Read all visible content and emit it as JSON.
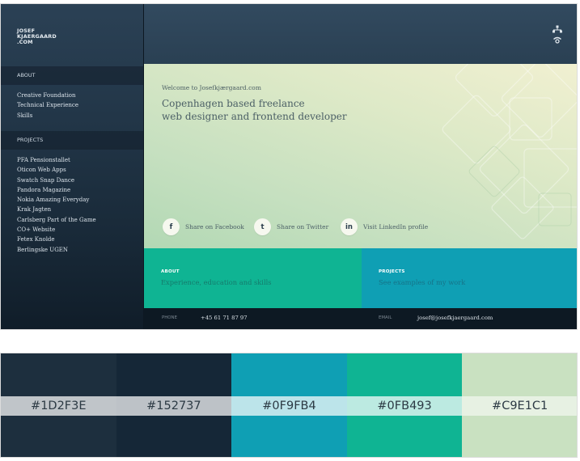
{
  "sidebar": {
    "logo_lines": [
      "JOSEF",
      "KJAERGAARD",
      ".COM"
    ],
    "about_heading": "ABOUT",
    "about_items": [
      "Creative Foundation",
      "Technical Experience",
      "Skills"
    ],
    "projects_heading": "PROJECTS",
    "project_items": [
      "PFA Pensionstallet",
      "Oticon Web Apps",
      "Swatch Snap Dance",
      "Pandora Magazine",
      "Nokia Amazing Everyday",
      "Krak Jagten",
      "Carlsberg Part of the Game",
      "CO+ Website",
      "Fetex Knolde",
      "Berlingske UGEN"
    ]
  },
  "topbar": {
    "icons": [
      "network-icon",
      "wifi-icon"
    ]
  },
  "hero": {
    "welcome": "Welcome to Josefkjærgaard.com",
    "headline_line1": "Copenhagen based freelance",
    "headline_line2": "web designer and frontend developer"
  },
  "share": {
    "facebook_icon": "f",
    "facebook_label": "Share on Facebook",
    "twitter_icon": "t",
    "twitter_label": "Share on Twitter",
    "linkedin_icon": "in",
    "linkedin_label": "Visit LinkedIn profile"
  },
  "panels": {
    "about_title": "ABOUT",
    "about_sub": "Experience, education and skills",
    "projects_title": "PROJECTS",
    "projects_sub": "See examples of my work"
  },
  "footer": {
    "phone_label": "PHONE",
    "phone_value": "+45 61 71 87 97",
    "email_label": "EMAIL",
    "email_value": "josef@josefkjaergaard.com"
  },
  "palette": [
    {
      "hex": "#1D2F3E",
      "color": "#1d2f3e"
    },
    {
      "hex": "#152737",
      "color": "#152737"
    },
    {
      "hex": "#0F9FB4",
      "color": "#0f9fb4"
    },
    {
      "hex": "#0FB493",
      "color": "#0fb493"
    },
    {
      "hex": "#C9E1C1",
      "color": "#c9e1c1"
    }
  ]
}
